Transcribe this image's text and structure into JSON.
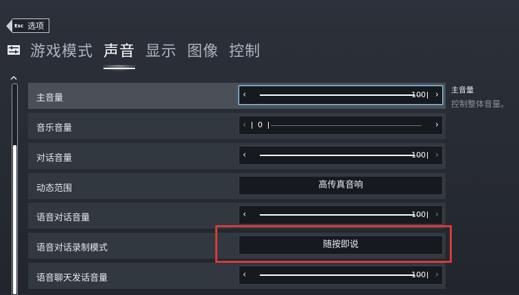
{
  "back": {
    "key": "Esc",
    "label": "选项"
  },
  "tabs": [
    {
      "label": "游戏模式",
      "active": false
    },
    {
      "label": "声音",
      "active": true
    },
    {
      "label": "显示",
      "active": false
    },
    {
      "label": "图像",
      "active": false
    },
    {
      "label": "控制",
      "active": false
    }
  ],
  "rows": [
    {
      "label": "主音量",
      "type": "slider",
      "value": "100",
      "selected": true
    },
    {
      "label": "音乐音量",
      "type": "slider",
      "value": "0",
      "selected": false
    },
    {
      "label": "对话音量",
      "type": "slider",
      "value": "100",
      "selected": false
    },
    {
      "label": "动态范围",
      "type": "select",
      "value": "高传真音响",
      "selected": false
    },
    {
      "label": "语音对话音量",
      "type": "slider",
      "value": "100",
      "selected": false
    },
    {
      "label": "语音对话录制模式",
      "type": "select",
      "value": "随按即说",
      "selected": false
    },
    {
      "label": "语音聊天发话音量",
      "type": "slider",
      "value": "100",
      "selected": false
    }
  ],
  "info": {
    "title": "主音量",
    "description": "控制整体音量。"
  },
  "colors": {
    "selection_border": "#8fc8ee",
    "highlight": "#d93b3b",
    "row_bg": "#323840",
    "row_selected_bg": "#4a5058"
  }
}
